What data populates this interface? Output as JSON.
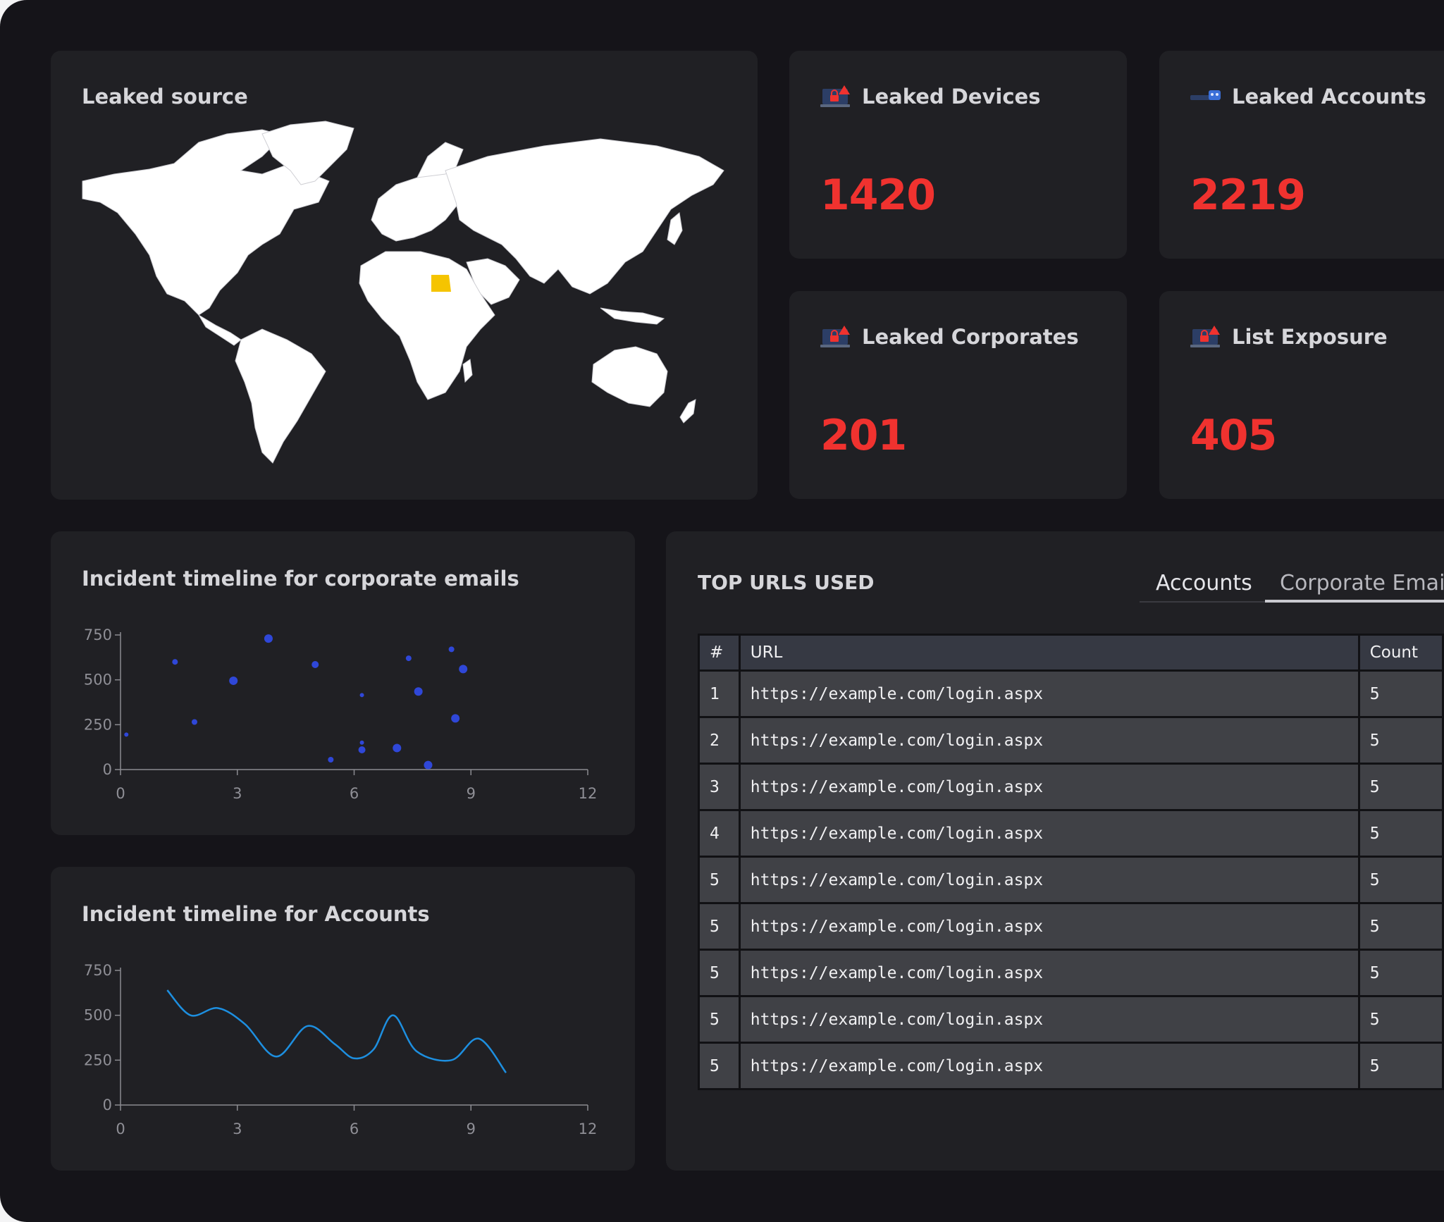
{
  "leaked_source": {
    "title": "Leaked source",
    "highlight_color": "#f5c400"
  },
  "stats": [
    {
      "title": "Leaked Devices",
      "value": "1420",
      "icon": "lock-laptop-icon"
    },
    {
      "title": "Leaked Accounts",
      "value": "2219",
      "icon": "account-card-icon"
    },
    {
      "title": "Leaked Corporates",
      "value": "201",
      "icon": "lock-laptop-icon"
    },
    {
      "title": "List Exposure",
      "value": "405",
      "icon": "lock-laptop-icon"
    }
  ],
  "accent_colors": {
    "stat_value": "#f0322f",
    "scatter": "#2f47d8",
    "line": "#1d8fe0"
  },
  "scatter_card": {
    "title": "Incident timeline for corporate emails"
  },
  "line_card": {
    "title": "Incident timeline for Accounts"
  },
  "chart_data": [
    {
      "type": "scatter",
      "title": "Incident timeline for corporate emails",
      "xlim": [
        0,
        12
      ],
      "ylim": [
        0,
        750
      ],
      "x_ticks": [
        "0",
        "3",
        "6",
        "9",
        "12"
      ],
      "y_ticks": [
        "0",
        "250",
        "500",
        "750"
      ],
      "points": [
        {
          "x": 0.15,
          "y": 195
        },
        {
          "x": 1.4,
          "y": 600
        },
        {
          "x": 1.9,
          "y": 265
        },
        {
          "x": 2.9,
          "y": 495
        },
        {
          "x": 3.8,
          "y": 730
        },
        {
          "x": 5.0,
          "y": 585
        },
        {
          "x": 5.4,
          "y": 55
        },
        {
          "x": 6.2,
          "y": 110
        },
        {
          "x": 6.2,
          "y": 150
        },
        {
          "x": 6.2,
          "y": 415
        },
        {
          "x": 7.1,
          "y": 120
        },
        {
          "x": 7.4,
          "y": 620
        },
        {
          "x": 7.65,
          "y": 435
        },
        {
          "x": 7.9,
          "y": 25
        },
        {
          "x": 8.5,
          "y": 670
        },
        {
          "x": 8.6,
          "y": 285
        },
        {
          "x": 8.8,
          "y": 560
        }
      ]
    },
    {
      "type": "line",
      "title": "Incident timeline for Accounts",
      "xlim": [
        0,
        12
      ],
      "ylim": [
        0,
        750
      ],
      "x_ticks": [
        "0",
        "3",
        "6",
        "9",
        "12"
      ],
      "y_ticks": [
        "0",
        "250",
        "500",
        "750"
      ],
      "x": [
        1.2,
        1.8,
        2.5,
        3.2,
        4.0,
        4.8,
        5.5,
        6.0,
        6.5,
        7.0,
        7.6,
        8.5,
        9.2,
        9.9
      ],
      "y": [
        640,
        500,
        540,
        450,
        270,
        440,
        340,
        260,
        310,
        500,
        300,
        250,
        370,
        180
      ]
    }
  ],
  "top_urls": {
    "title": "TOP URLS USED",
    "tabs": [
      "Accounts",
      "Corporate Emails"
    ],
    "active_tab": "Corporate Emails",
    "columns": [
      "#",
      "URL",
      "Count"
    ],
    "rows": [
      [
        "1",
        "https://example.com/login.aspx",
        "5"
      ],
      [
        "2",
        "https://example.com/login.aspx",
        "5"
      ],
      [
        "3",
        "https://example.com/login.aspx",
        "5"
      ],
      [
        "4",
        "https://example.com/login.aspx",
        "5"
      ],
      [
        "5",
        "https://example.com/login.aspx",
        "5"
      ],
      [
        "5",
        "https://example.com/login.aspx",
        "5"
      ],
      [
        "5",
        "https://example.com/login.aspx",
        "5"
      ],
      [
        "5",
        "https://example.com/login.aspx",
        "5"
      ],
      [
        "5",
        "https://example.com/login.aspx",
        "5"
      ]
    ]
  }
}
